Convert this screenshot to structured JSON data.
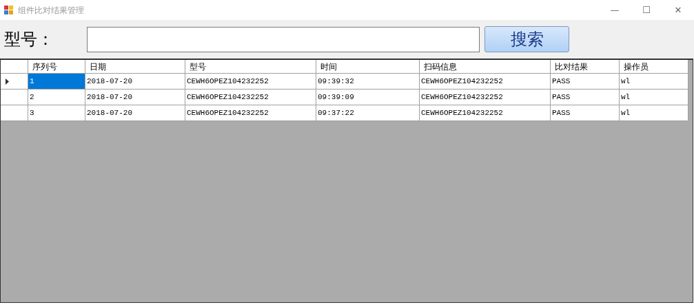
{
  "window": {
    "title": "组件比对结果管理",
    "controls": [
      "—",
      "☐",
      "✕"
    ]
  },
  "search": {
    "label": "型号：",
    "button": "搜索"
  },
  "table": {
    "columns": [
      "序列号",
      "日期",
      "型号",
      "时间",
      "扫码信息",
      "比对结果",
      "操作员"
    ],
    "rows": [
      {
        "current": true,
        "cells": [
          {
            "text": "1",
            "selected": true
          },
          {
            "text": "2018-07-20",
            "selected": false
          },
          {
            "text": "CEWH6OPEZ104232252",
            "selected": false
          },
          {
            "text": "09:39:32",
            "selected": false
          },
          {
            "text": "CEWH6OPEZ104232252",
            "selected": false
          },
          {
            "text": "PASS",
            "selected": false
          },
          {
            "text": "wl",
            "selected": false
          }
        ]
      },
      {
        "current": false,
        "cells": [
          {
            "text": "2",
            "selected": false
          },
          {
            "text": "2018-07-20",
            "selected": false
          },
          {
            "text": "CEWH6OPEZ104232252",
            "selected": false
          },
          {
            "text": "09:39:09",
            "selected": false
          },
          {
            "text": "CEWH6OPEZ104232252",
            "selected": false
          },
          {
            "text": "PASS",
            "selected": false
          },
          {
            "text": "wl",
            "selected": false
          }
        ]
      },
      {
        "current": false,
        "cells": [
          {
            "text": "3",
            "selected": false
          },
          {
            "text": "2018-07-20",
            "selected": false
          },
          {
            "text": "CEWH6OPEZ104232252",
            "selected": false
          },
          {
            "text": "09:37:22",
            "selected": false
          },
          {
            "text": "CEWH6OPEZ104232252",
            "selected": false
          },
          {
            "text": "PASS",
            "selected": false
          },
          {
            "text": "wl",
            "selected": false
          }
        ]
      }
    ]
  }
}
